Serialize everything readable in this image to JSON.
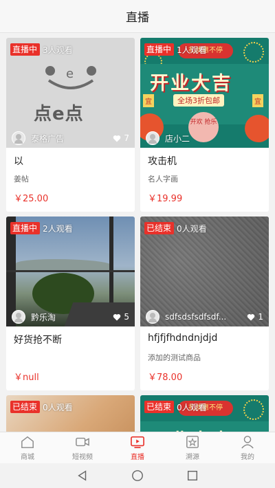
{
  "header": {
    "title": "直播"
  },
  "cards": [
    {
      "badge": "直播中",
      "viewers": "3人观看",
      "shop": "泰格广告",
      "likes": "7",
      "name": "以",
      "desc": "姜帖",
      "price": "￥25.00",
      "logo": "点e点"
    },
    {
      "badge": "直播中",
      "viewers": "1人观看",
      "shop": "店小二",
      "likes": "",
      "name": "攻击机",
      "desc": "名人字画",
      "price": "￥19.99",
      "poster_title": "开业大吉",
      "poster_sub": "全场3折包邮",
      "poster_top": "礼优惠不停",
      "poster_circle": "开欢 抢乐",
      "seal": "宜"
    },
    {
      "badge": "直播中",
      "viewers": "2人观看",
      "shop": "黔乐淘",
      "likes": "5",
      "name": "好货抢不断",
      "desc": "",
      "price": "￥null"
    },
    {
      "badge": "已结束",
      "viewers": "0人观看",
      "shop": "sdfsdsfsdfsdf...",
      "likes": "1",
      "name": "hfjfjfhdndnjdjd",
      "desc": "添加的测试商品",
      "price": "￥78.00"
    },
    {
      "badge": "已结束",
      "viewers": "0人观看"
    },
    {
      "badge": "已结束",
      "viewers": "0人观看"
    }
  ],
  "tabs": [
    {
      "label": "商城",
      "icon": "home-icon"
    },
    {
      "label": "短视频",
      "icon": "video-camera-icon"
    },
    {
      "label": "直播",
      "icon": "live-tv-icon"
    },
    {
      "label": "溯源",
      "icon": "star-badge-icon"
    },
    {
      "label": "我的",
      "icon": "person-icon"
    }
  ],
  "colors": {
    "accent": "#e9312a",
    "tab_inactive": "#8a8a8a"
  }
}
